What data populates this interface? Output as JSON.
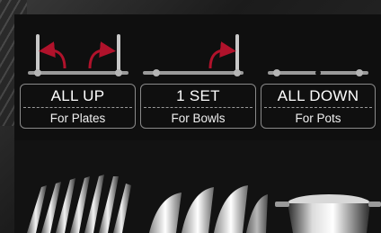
{
  "options": [
    {
      "title": "ALL UP",
      "subtitle": "For Plates"
    },
    {
      "title": "1 SET",
      "subtitle": "For Bowls"
    },
    {
      "title": "ALL DOWN",
      "subtitle": "For Pots"
    }
  ],
  "colors": {
    "panel": "#0f0f0f",
    "rail": "#9a9a9a",
    "arrow": "#b0122b",
    "box_border": "#8a8a8a",
    "text": "#ffffff"
  },
  "icons": [
    "rack-all-up-icon",
    "rack-one-set-icon",
    "rack-all-down-icon",
    "curved-arrow-icon"
  ]
}
